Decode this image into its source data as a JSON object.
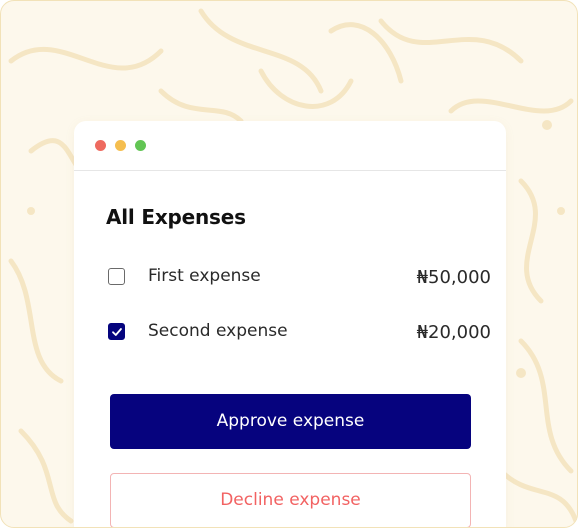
{
  "card": {
    "title": "All Expenses",
    "items": [
      {
        "label": "First expense",
        "amount": "₦50,000",
        "checked": false
      },
      {
        "label": "Second expense",
        "amount": "₦20,000",
        "checked": true
      }
    ],
    "approve_label": "Approve expense",
    "decline_label": "Decline expense"
  },
  "colors": {
    "primary": "#06037E",
    "decline_text": "#F26262",
    "decline_border": "#F3B4B4",
    "background": "#FDF8EC",
    "traffic_red": "#EE6A5F",
    "traffic_yellow": "#F5BE4F",
    "traffic_green": "#62C554"
  }
}
